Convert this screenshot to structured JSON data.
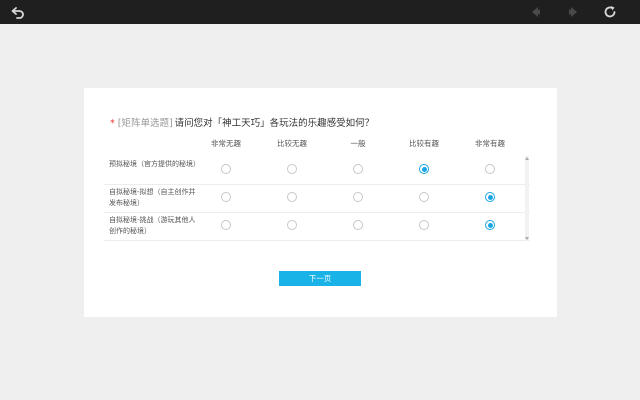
{
  "toolbar": {
    "back_icon": "back-arrow-icon",
    "prev_icon": "nav-prev-icon",
    "next_icon": "nav-next-icon",
    "refresh_icon": "refresh-icon"
  },
  "question": {
    "required_mark": "*",
    "type": "[矩阵单选题]",
    "text": "请问您对「神工天巧」各玩法的乐趣感受如何？"
  },
  "columns": [
    "非常无趣",
    "比较无趣",
    "一般",
    "比较有趣",
    "非常有趣"
  ],
  "rows": [
    {
      "label": "预拟秘境（官方提供的秘境）",
      "selected": 3
    },
    {
      "label": "自拟秘境-拟想（自主创作并发布秘境）",
      "selected": 4
    },
    {
      "label": "自拟秘境-挑战（游玩其他人创作的秘境）",
      "selected": 4
    }
  ],
  "next_button": {
    "label": "下一页"
  },
  "colors": {
    "accent": "#1ab3e8",
    "required": "#e4393c",
    "topbar": "#1f1f1f"
  }
}
